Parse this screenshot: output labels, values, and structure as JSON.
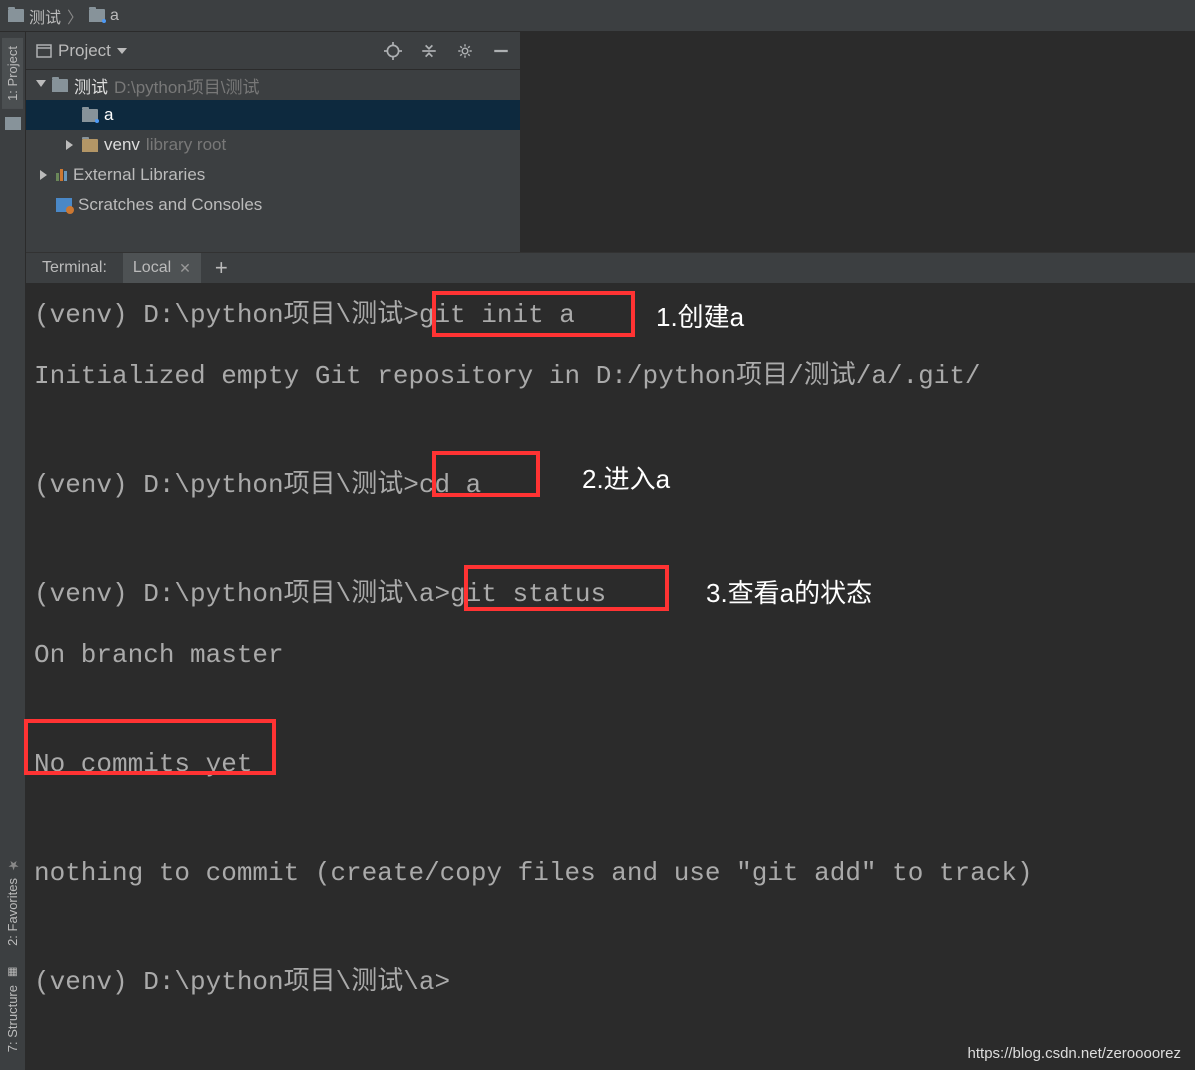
{
  "breadcrumb": {
    "root": "测试",
    "child": "a"
  },
  "sidebar": {
    "project": "1: Project",
    "favorites": "2: Favorites",
    "structure": "7: Structure"
  },
  "project": {
    "header": "Project",
    "root_name": "测试",
    "root_path": "D:\\python项目\\测试",
    "folder_a": "a",
    "venv": "venv",
    "venv_note": "library root",
    "ext_libs": "External Libraries",
    "scratches": "Scratches and Consoles"
  },
  "terminal": {
    "title": "Terminal:",
    "tab": "Local",
    "lines": {
      "l1": "(venv) D:\\python项目\\测试>git init a",
      "l2": "Initialized empty Git repository in D:/python项目/测试/a/.git/",
      "l3": "(venv) D:\\python项目\\测试>cd a",
      "l4": "(venv) D:\\python项目\\测试\\a>git status",
      "l5": "On branch master",
      "l6": "No commits yet",
      "l7": "nothing to commit (create/copy files and use \"git add\" to track)",
      "l8": "(venv) D:\\python项目\\测试\\a>"
    }
  },
  "annotations": {
    "a1": "1.创建a",
    "a2": "2.进入a",
    "a3": "3.查看a的状态"
  },
  "watermark": "https://blog.csdn.net/zeroooorez"
}
